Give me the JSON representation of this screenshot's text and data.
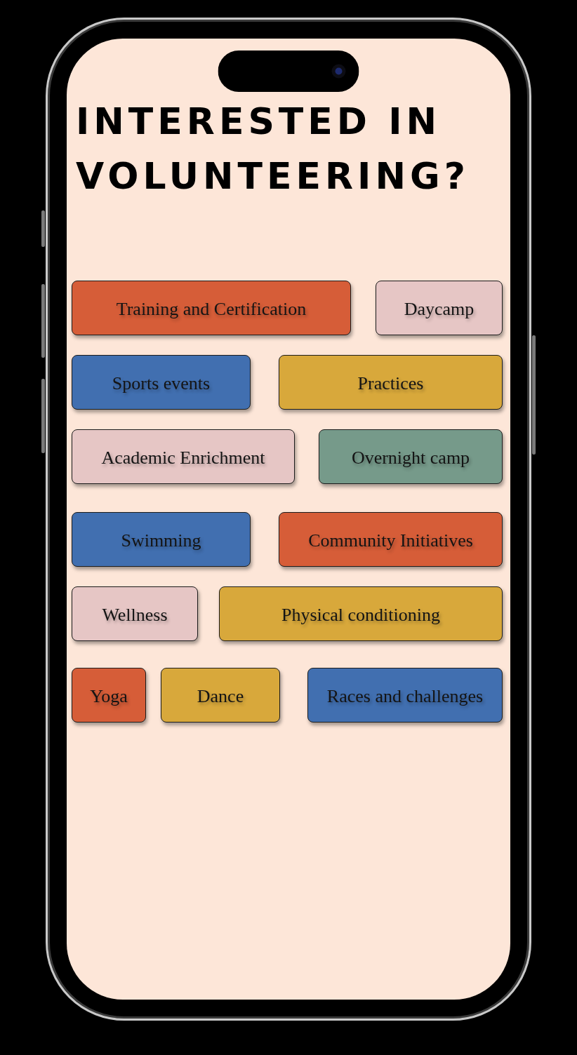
{
  "title": "INTERESTED IN VOLUNTEERING?",
  "options": [
    {
      "label": "Training and Certification",
      "color": "#d65d38"
    },
    {
      "label": "Daycamp",
      "color": "#e6c6c5"
    },
    {
      "label": "Sports events",
      "color": "#416fb0"
    },
    {
      "label": "Practices",
      "color": "#d8a83b"
    },
    {
      "label": "Academic Enrichment",
      "color": "#e6c6c5"
    },
    {
      "label": "Overnight camp",
      "color": "#769a8a"
    },
    {
      "label": "Swimming",
      "color": "#416fb0"
    },
    {
      "label": "Community Initiatives",
      "color": "#d65d38"
    },
    {
      "label": "Wellness",
      "color": "#e6c6c5"
    },
    {
      "label": "Physical conditioning",
      "color": "#d8a83b"
    },
    {
      "label": "Yoga",
      "color": "#d65d38"
    },
    {
      "label": "Dance",
      "color": "#d8a83b"
    },
    {
      "label": "Races and challenges",
      "color": "#416fb0"
    }
  ]
}
